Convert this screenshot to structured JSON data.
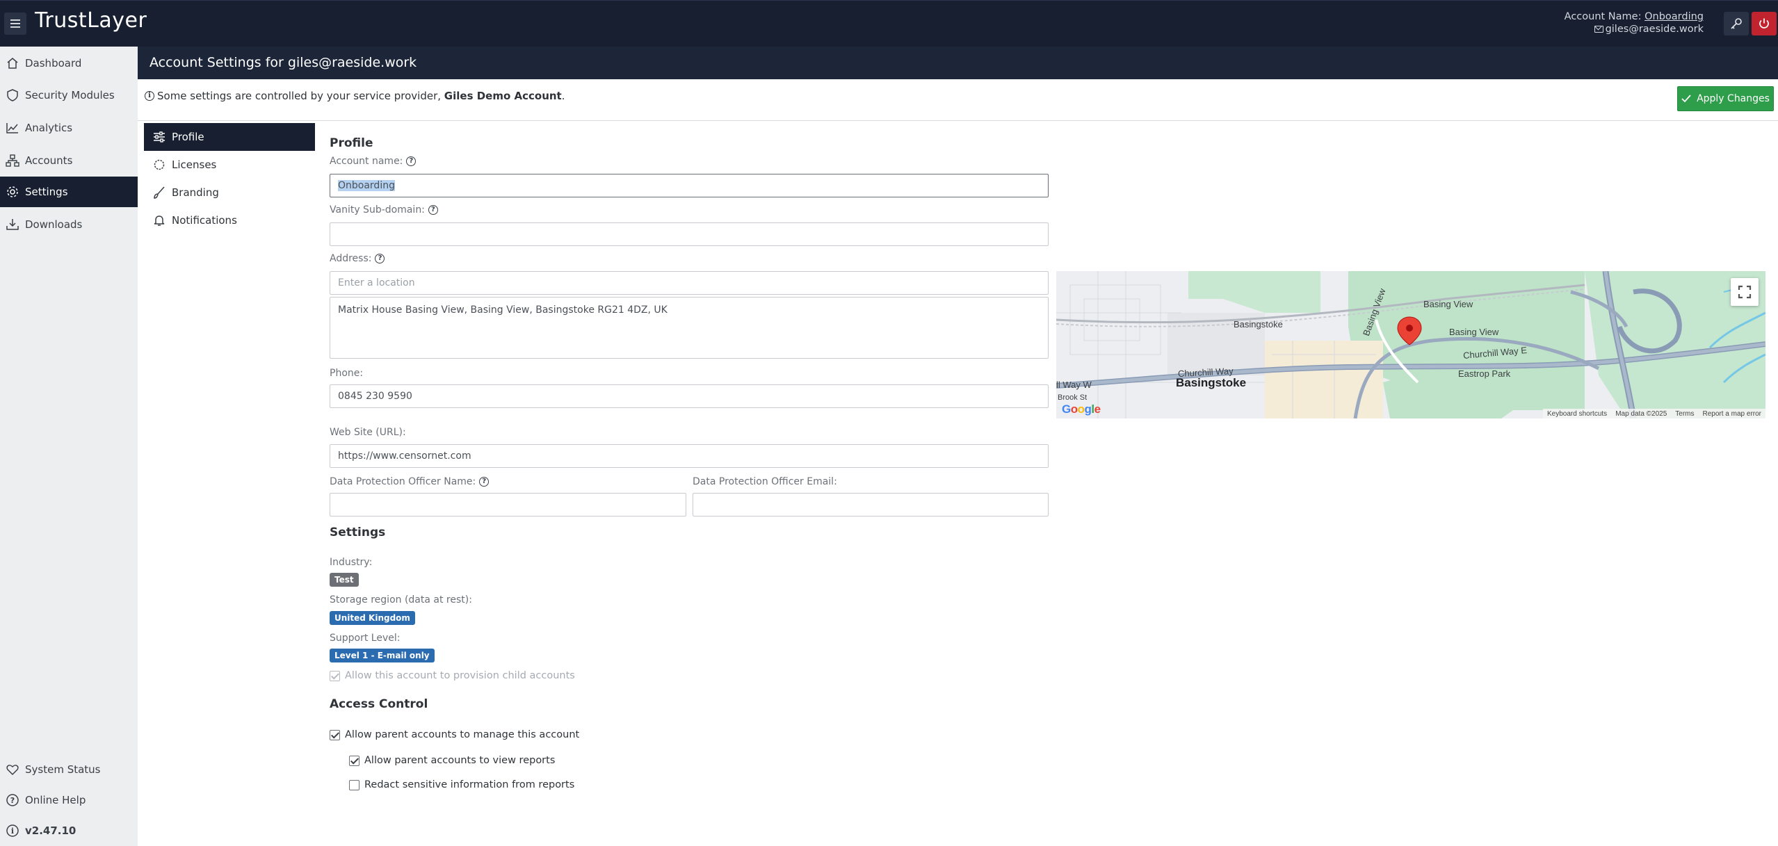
{
  "app": {
    "brand": "TrustLayer",
    "account_name_label": "Account Name:",
    "account_name": "Onboarding",
    "user_email": "giles@raeside.work"
  },
  "sidebar": {
    "items": [
      {
        "label": "Dashboard",
        "icon": "home-icon"
      },
      {
        "label": "Security Modules",
        "icon": "shield-icon"
      },
      {
        "label": "Analytics",
        "icon": "chart-icon"
      },
      {
        "label": "Accounts",
        "icon": "org-icon"
      },
      {
        "label": "Settings",
        "icon": "gear-icon",
        "active": true
      },
      {
        "label": "Downloads",
        "icon": "download-icon"
      }
    ],
    "bottom": [
      {
        "label": "System Status",
        "icon": "heart-icon"
      },
      {
        "label": "Online Help",
        "icon": "help-icon"
      },
      {
        "label": "v2.47.10",
        "icon": "info-icon"
      }
    ]
  },
  "header": {
    "title": "Account Settings for giles@raeside.work"
  },
  "notice": {
    "text_prefix": "Some settings are controlled by your service provider, ",
    "provider": "Giles Demo Account",
    "text_suffix": ".",
    "apply_label": "Apply Changes"
  },
  "subnav": {
    "items": [
      {
        "label": "Profile",
        "icon": "sliders-icon",
        "active": true
      },
      {
        "label": "Licenses",
        "icon": "badge-icon"
      },
      {
        "label": "Branding",
        "icon": "brush-icon"
      },
      {
        "label": "Notifications",
        "icon": "bell-icon"
      }
    ]
  },
  "profile": {
    "title": "Profile",
    "account_name_label": "Account name:",
    "account_name_value": "Onboarding",
    "vanity_label": "Vanity Sub-domain:",
    "vanity_value": "",
    "address_label": "Address:",
    "address_placeholder": "Enter a location",
    "address_value": "Matrix House Basing View, Basing View, Basingstoke RG21 4DZ, UK",
    "phone_label": "Phone:",
    "phone_value": "0845 230 9590",
    "website_label": "Web Site (URL):",
    "website_value": "https://www.censornet.com",
    "dpo_name_label": "Data Protection Officer Name:",
    "dpo_name_value": "",
    "dpo_email_label": "Data Protection Officer Email:",
    "dpo_email_value": ""
  },
  "settings": {
    "title": "Settings",
    "industry_label": "Industry:",
    "industry_value": "Test",
    "storage_label": "Storage region (data at rest):",
    "storage_value": "United Kingdom",
    "support_label": "Support Level:",
    "support_value": "Level 1 - E-mail only",
    "child_accounts_label": "Allow this account to provision child accounts",
    "child_accounts_checked": true
  },
  "access_control": {
    "title": "Access Control",
    "manage_label": "Allow parent accounts to manage this account",
    "manage_checked": true,
    "view_reports_label": "Allow parent accounts to view reports",
    "view_reports_checked": true,
    "redact_label": "Redact sensitive information from reports",
    "redact_checked": false
  },
  "map": {
    "labels": {
      "basingstoke_station": "Basingstoke",
      "basing_view_1": "Basing View",
      "basing_view_2": "Basing View",
      "basing_view_road": "Basing View",
      "churchill_way_e": "Churchill Way E",
      "churchill_way": "Churchill Way",
      "eastrop_park": "Eastrop Park",
      "basingstoke_town": "Basingstoke",
      "ll_way_w": "ll Way W",
      "brook_st": "Brook St"
    },
    "footer": {
      "shortcuts": "Keyboard shortcuts",
      "data": "Map data ©2025",
      "terms": "Terms",
      "report": "Report a map error"
    },
    "logo": "Google"
  }
}
